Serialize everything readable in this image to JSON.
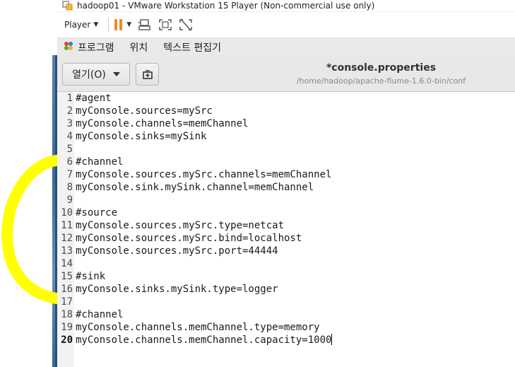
{
  "vm_window": {
    "title": "hadoop01 - VMware Workstation 15 Player (Non-commercial use only)",
    "player_menu_label": "Player"
  },
  "gnome_menubar": {
    "items": [
      "프로그램",
      "위치",
      "텍스트 편집기"
    ]
  },
  "gedit": {
    "open_button_label": "열기(O)",
    "title": "*console.properties",
    "path": "/home/hadoop/apache-flume-1.6.0-bin/conf"
  },
  "editor": {
    "current_line": 20,
    "lines": [
      {
        "n": "1",
        "text": "#agent"
      },
      {
        "n": "2",
        "text": "myConsole.sources=mySrc"
      },
      {
        "n": "3",
        "text": "myConsole.channels=memChannel"
      },
      {
        "n": "4",
        "text": "myConsole.sinks=mySink"
      },
      {
        "n": "5",
        "text": ""
      },
      {
        "n": "6",
        "text": "#channel"
      },
      {
        "n": "7",
        "text": "myConsole.sources.mySrc.channels=memChannel"
      },
      {
        "n": "8",
        "text": "myConsole.sink.mySink.channel=memChannel"
      },
      {
        "n": "9",
        "text": ""
      },
      {
        "n": "10",
        "text": "#source"
      },
      {
        "n": "11",
        "text": "myConsole.sources.mySrc.type=netcat"
      },
      {
        "n": "12",
        "text": "myConsole.sources.mySrc.bind=localhost"
      },
      {
        "n": "13",
        "text": "myConsole.sources.mySrc.port=44444"
      },
      {
        "n": "14",
        "text": ""
      },
      {
        "n": "15",
        "text": "#sink"
      },
      {
        "n": "16",
        "text": "myConsole.sinks.mySink.type=logger"
      },
      {
        "n": "17",
        "text": ""
      },
      {
        "n": "18",
        "text": "#channel"
      },
      {
        "n": "19",
        "text": "myConsole.channels.memChannel.type=memory"
      },
      {
        "n": "20",
        "text": "myConsole.channels.memChannel.capacity=1000"
      }
    ]
  },
  "icons": {
    "app": "vmware-app-icon",
    "pause": "pause-icon",
    "send_keys": "send-ctrl-alt-del-icon",
    "fullscreen": "fullscreen-icon",
    "unity": "unity-icon",
    "apps": "gnome-apps-icon",
    "open_dropdown": "chevron-down-icon",
    "new_tab": "new-document-icon"
  },
  "colors": {
    "accent_pause": "#f08a24",
    "highlighter": "#ffff00"
  }
}
